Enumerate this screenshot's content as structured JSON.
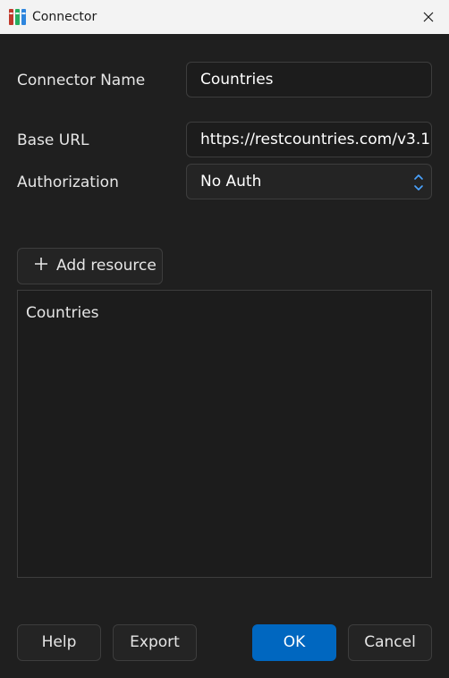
{
  "window": {
    "title": "Connector"
  },
  "form": {
    "connector_name_label": "Connector Name",
    "connector_name_value": "Countries",
    "base_url_label": "Base URL",
    "base_url_value": "https://restcountries.com/v3.1",
    "authorization_label": "Authorization",
    "authorization_value": "No Auth"
  },
  "resources": {
    "add_label": "Add resource",
    "items": [
      "Countries"
    ]
  },
  "footer": {
    "help_label": "Help",
    "export_label": "Export",
    "ok_label": "OK",
    "cancel_label": "Cancel"
  },
  "colors": {
    "accent": "#0067c0",
    "background": "#1f1f1f",
    "titlebar": "#f3f3f3"
  }
}
